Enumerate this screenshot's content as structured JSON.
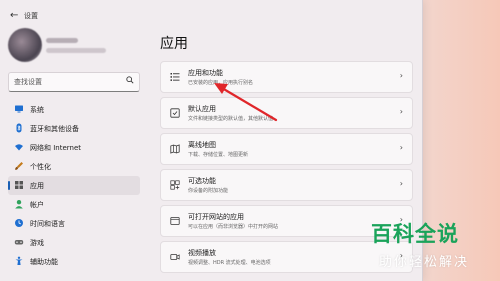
{
  "window": {
    "title": "设置",
    "back_icon": "back-arrow-icon"
  },
  "sidebar": {
    "search_placeholder": "查找设置",
    "items": [
      {
        "label": "系统",
        "icon": "monitor-icon",
        "color": "#1f6fd1"
      },
      {
        "label": "蓝牙和其他设备",
        "icon": "bluetooth-icon",
        "color": "#1f6fd1"
      },
      {
        "label": "网络和 Internet",
        "icon": "wifi-icon",
        "color": "#1f6fd1"
      },
      {
        "label": "个性化",
        "icon": "brush-icon",
        "color": "#c47b1b"
      },
      {
        "label": "应用",
        "icon": "apps-icon",
        "color": "#555555",
        "active": true
      },
      {
        "label": "帐户",
        "icon": "person-icon",
        "color": "#2fa35c"
      },
      {
        "label": "时间和语言",
        "icon": "globe-clock-icon",
        "color": "#1f6fd1"
      },
      {
        "label": "游戏",
        "icon": "gamepad-icon",
        "color": "#666666"
      },
      {
        "label": "辅助功能",
        "icon": "accessibility-icon",
        "color": "#1f6fd1"
      }
    ]
  },
  "main": {
    "title": "应用",
    "cards": [
      {
        "title": "应用和功能",
        "subtitle": "已安装的应用，应用执行别名",
        "icon": "list-icon"
      },
      {
        "title": "默认应用",
        "subtitle": "文件和链接类型的默认值，其他默认值",
        "icon": "default-apps-icon"
      },
      {
        "title": "离线地图",
        "subtitle": "下载、存储位置、地图更新",
        "icon": "map-icon"
      },
      {
        "title": "可选功能",
        "subtitle": "你设备的附加功能",
        "icon": "optional-features-icon"
      },
      {
        "title": "可打开网站的应用",
        "subtitle": "可以在应用（而非浏览器）中打开的网站",
        "icon": "web-apps-icon"
      },
      {
        "title": "视频播放",
        "subtitle": "视频调整、HDR 流式处理、电池选项",
        "icon": "video-icon"
      }
    ]
  },
  "watermark": {
    "main": "百科全说",
    "sub": "助你轻松解决"
  }
}
